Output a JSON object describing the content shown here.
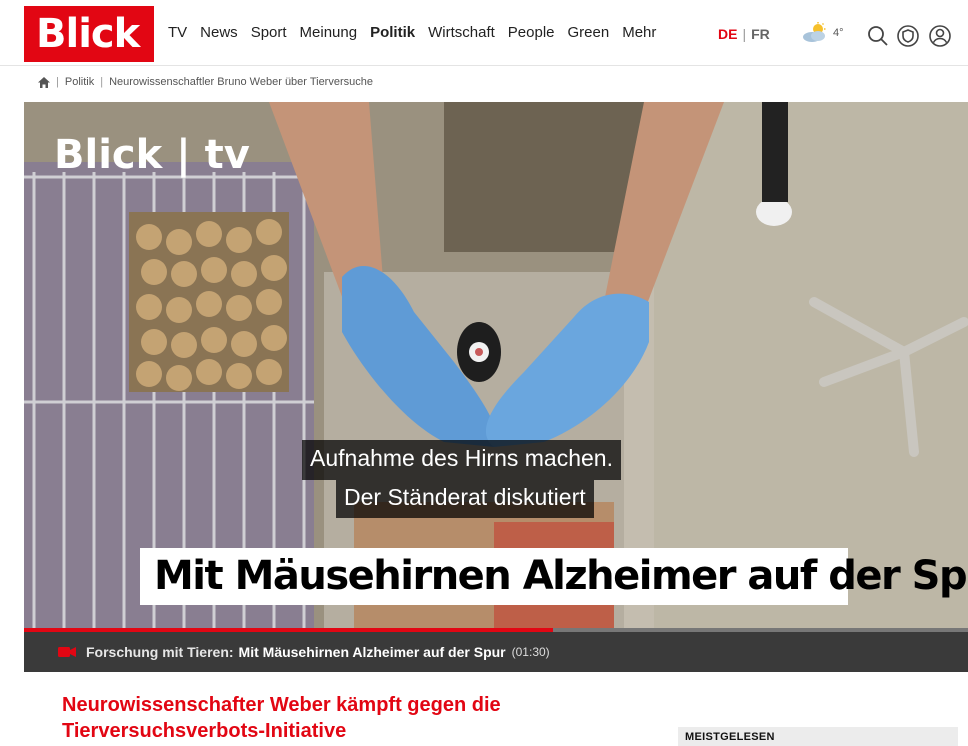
{
  "header": {
    "logo": "Blick",
    "nav": [
      "TV",
      "News",
      "Sport",
      "Meinung",
      "Politik",
      "Wirtschaft",
      "People",
      "Green",
      "Mehr"
    ],
    "active_nav": "Politik",
    "lang_de": "DE",
    "lang_fr": "FR",
    "weather_temp": "4°",
    "icons": [
      "weather-icon",
      "search-icon",
      "shield-icon",
      "user-icon"
    ]
  },
  "breadcrumb": {
    "items": [
      "Politik",
      "Neurowissenschaftler Bruno Weber über Tierversuche"
    ]
  },
  "video": {
    "logo": "Blick | tv",
    "subtitle_line1": "Aufnahme des Hirns machen.",
    "subtitle_line2": "Der Ständerat diskutiert",
    "headline": "Mit Mäusehirnen Alzheimer auf der Spur",
    "progress": 0.56,
    "caption_category": "Forschung mit Tieren:",
    "caption_title": "Mit Mäusehirnen Alzheimer auf der Spur",
    "caption_duration": "(01:30)"
  },
  "article": {
    "title_line1": "Neurowissenschafter Weber kämpft gegen die",
    "title_line2": "Tierversuchsverbots-Initiative"
  },
  "sidebar": {
    "label": "MEISTGELESEN"
  },
  "colors": {
    "brand": "#e20613",
    "caption_bar": "#3a3a3a"
  }
}
